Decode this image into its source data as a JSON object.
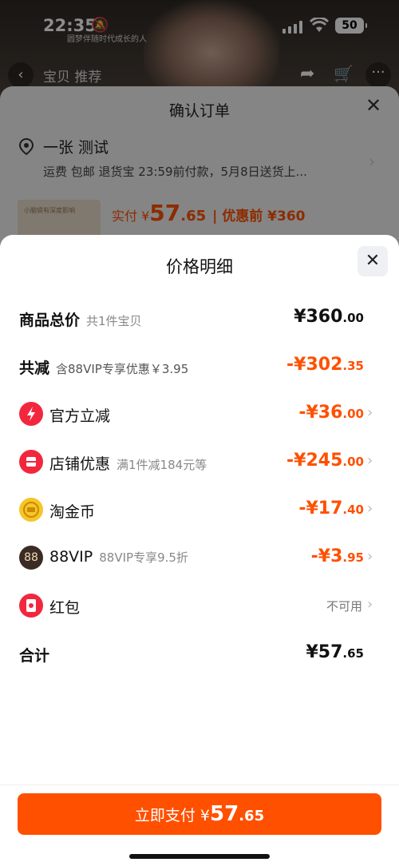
{
  "status_bar": {
    "time": "22:35",
    "battery": "50"
  },
  "product_header": {
    "tabs": "宝贝 推荐"
  },
  "background": {
    "caption": "圆梦伴随时代成长的人"
  },
  "confirm_order": {
    "title": "确认订单",
    "recipient": "一张 测试",
    "shipping": "运费 包邮 退货宝 23:59前付款，5月8日送货上...",
    "pay_label": "实付 ¥",
    "pay_int": "57",
    "pay_dec": ".65",
    "pre_discount": "| 优惠前 ¥360",
    "thumb_text": "小脑袋有深度影响"
  },
  "price_detail": {
    "title": "价格明细",
    "rows": [
      {
        "label": "商品总价",
        "sub": "共1件宝贝",
        "value_int": "¥360",
        "value_dec": ".00",
        "color": "#111111"
      },
      {
        "label": "共减",
        "sub": "含88VIP专享优惠￥3.95",
        "value_int": "-¥302",
        "value_dec": ".35",
        "color": "#ff5000"
      },
      {
        "label": "官方立减",
        "sub": "",
        "value_int": "-¥36",
        "value_dec": ".00",
        "icon": "lightning-icon"
      },
      {
        "label": "店铺优惠",
        "sub": "满1件减184元等",
        "value_int": "-¥245",
        "value_dec": ".00",
        "icon": "shop-icon"
      },
      {
        "label": "淘金币",
        "sub": "",
        "value_int": "-¥17",
        "value_dec": ".40",
        "icon": "coin-icon"
      },
      {
        "label": "88VIP",
        "sub": "88VIP专享9.5折",
        "value_int": "-¥3",
        "value_dec": ".95",
        "icon": "vip-88-icon",
        "icon_text": "88"
      },
      {
        "label": "红包",
        "sub": "",
        "value_text": "不可用",
        "icon": "red-packet-icon"
      },
      {
        "label": "合计",
        "sub": "",
        "value_int": "¥57",
        "value_dec": ".65",
        "color": "#111111"
      }
    ]
  },
  "pay_button": {
    "label": "立即支付 ¥",
    "int": "57",
    "dec": ".65"
  },
  "colors": {
    "accent": "#ff5000",
    "icon_red": "#f2273e",
    "coin": "#f6c52a"
  }
}
